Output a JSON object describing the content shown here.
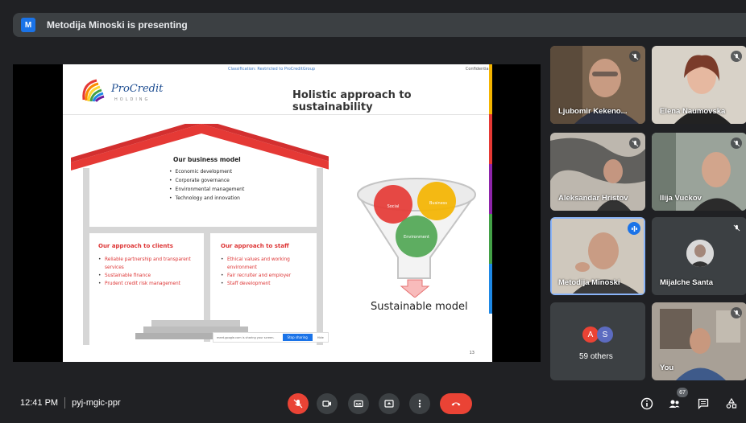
{
  "presenter_bar": {
    "avatar_letter": "M",
    "title": "Metodija Minoski is presenting"
  },
  "slide": {
    "classification": "Classification: Restricted to ProCreditGroup",
    "confidential": "Confidential",
    "logo_name": "ProCredit",
    "logo_sub": "HOLDING",
    "heading": "Holistic approach to sustainability",
    "business_model": {
      "title": "Our business model",
      "items": [
        "Economic development",
        "Corporate governance",
        "Environmental management",
        "Technology and innovation"
      ]
    },
    "clients": {
      "title": "Our approach to clients",
      "items": [
        "Reliable partnership and transparent services",
        "Sustainable finance",
        "Prudent credit risk management"
      ]
    },
    "staff": {
      "title": "Our approach to staff",
      "items": [
        "Ethical values and working environment",
        "Fair recruiter and employer",
        "Staff development"
      ]
    },
    "circles": {
      "social": "Social",
      "business": "Business",
      "environment": "Environment"
    },
    "funnel_caption": "Sustainable model",
    "share_text": "meet.google.com is sharing your screen.",
    "stop_sharing": "Stop sharing",
    "hide": "Hide",
    "page_number": "13"
  },
  "participants": [
    {
      "name": "Ljubomir Kekeno...",
      "muted": true
    },
    {
      "name": "Elena Naumovska",
      "muted": true
    },
    {
      "name": "Aleksandar Hristov",
      "muted": true
    },
    {
      "name": "Ilija Vuckov",
      "muted": true
    },
    {
      "name": "Metodija Minoski",
      "muted": false,
      "speaking": true
    },
    {
      "name": "Mijalche Santa",
      "muted": true
    },
    {
      "name": "You",
      "muted": true
    }
  ],
  "others": {
    "avatar_1": "A",
    "avatar_2": "S",
    "label": "59 others"
  },
  "bottom_bar": {
    "time": "12:41 PM",
    "meeting_code": "pyj-mgic-ppr",
    "people_count": "67"
  },
  "colors": {
    "background": "#202124",
    "tile": "#3c4043",
    "accent_blue": "#1a73e8",
    "danger_red": "#ea4335"
  }
}
